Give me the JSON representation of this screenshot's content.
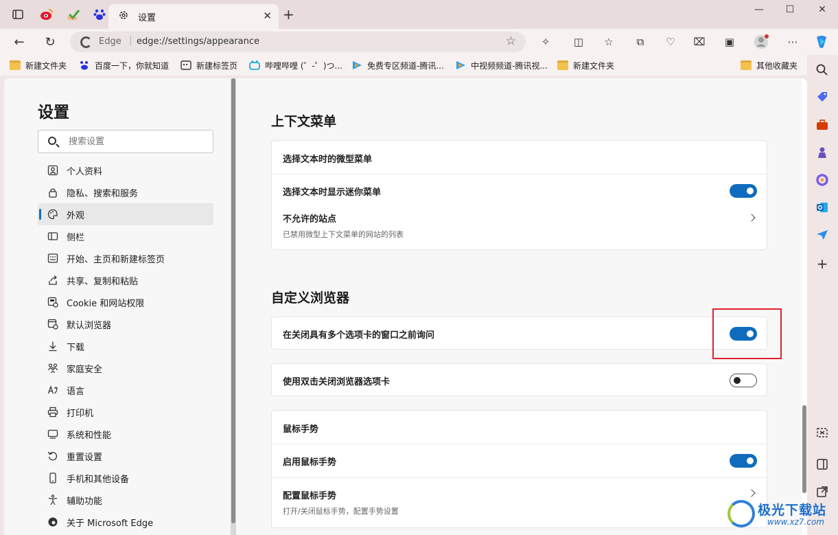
{
  "browser": {
    "tab_title": "设置",
    "address": {
      "site_label": "Edge",
      "url": "edge://settings/appearance"
    },
    "bookmarks": [
      "新建文件夹",
      "百度一下，你就知道",
      "新建标签页",
      "哔哩哔哩 (゜-゜)つ...",
      "免费专区频道-腾讯...",
      "中视频频道-腾讯视...",
      "新建文件夹"
    ],
    "other_bookmarks": "其他收藏夹"
  },
  "sidebar": {
    "title": "设置",
    "search_placeholder": "搜索设置",
    "items": [
      {
        "label": "个人资料",
        "icon": "profile-icon"
      },
      {
        "label": "隐私、搜索和服务",
        "icon": "lock-icon"
      },
      {
        "label": "外观",
        "icon": "palette-icon",
        "active": true
      },
      {
        "label": "侧栏",
        "icon": "sidebar-icon"
      },
      {
        "label": "开始、主页和新建标签页",
        "icon": "home-grid-icon"
      },
      {
        "label": "共享、复制和粘贴",
        "icon": "share-icon"
      },
      {
        "label": "Cookie 和网站权限",
        "icon": "cookie-permissions-icon"
      },
      {
        "label": "默认浏览器",
        "icon": "default-browser-icon"
      },
      {
        "label": "下载",
        "icon": "download-icon"
      },
      {
        "label": "家庭安全",
        "icon": "family-icon"
      },
      {
        "label": "语言",
        "icon": "language-icon"
      },
      {
        "label": "打印机",
        "icon": "printer-icon"
      },
      {
        "label": "系统和性能",
        "icon": "system-icon"
      },
      {
        "label": "重置设置",
        "icon": "reset-icon"
      },
      {
        "label": "手机和其他设备",
        "icon": "phone-icon"
      },
      {
        "label": "辅助功能",
        "icon": "accessibility-icon"
      },
      {
        "label": "关于 Microsoft Edge",
        "icon": "edge-icon"
      }
    ]
  },
  "main": {
    "context_menu": {
      "title": "上下文菜单",
      "card_header": "选择文本时的微型菜单",
      "mini_menu_label": "选择文本时显示迷你菜单",
      "mini_menu_on": true,
      "blocked_sites_label": "不允许的站点",
      "blocked_sites_sub": "已禁用微型上下文菜单的网站的列表"
    },
    "customize": {
      "title": "自定义浏览器",
      "ask_before_close_label": "在关闭具有多个选项卡的窗口之前询问",
      "ask_before_close_on": true,
      "double_click_close_label": "使用双击关闭浏览器选项卡",
      "double_click_close_on": false,
      "mouse_gesture_header": "鼠标手势",
      "mouse_gesture_enable_label": "启用鼠标手势",
      "mouse_gesture_on": true,
      "mouse_gesture_config_label": "配置鼠标手势",
      "mouse_gesture_config_sub": "打开/关闭鼠标手势，配置手势设置"
    }
  },
  "watermark": {
    "text": "极光下载站",
    "url": "www.xz7.com"
  },
  "colors": {
    "accent": "#0f6cbd",
    "highlight": "#e0202a"
  }
}
